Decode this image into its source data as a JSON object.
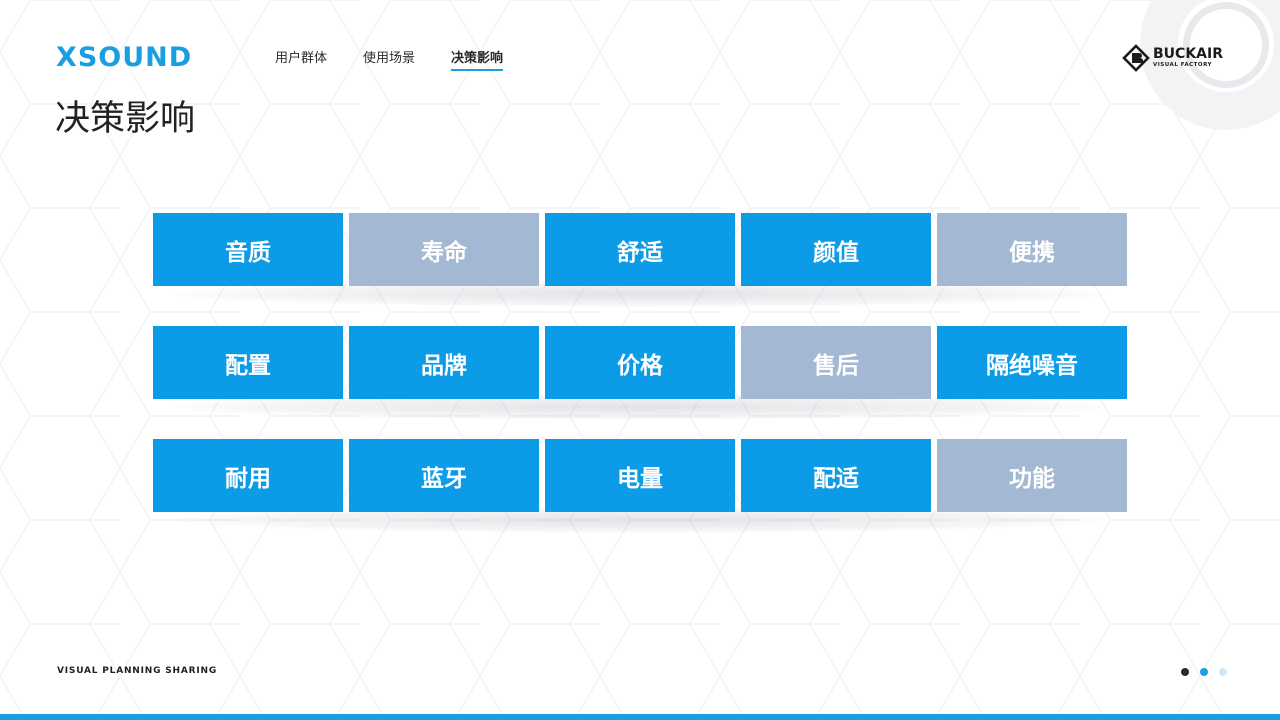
{
  "header": {
    "logo": "XSOUND",
    "nav": [
      {
        "label": "用户群体",
        "active": false
      },
      {
        "label": "使用场景",
        "active": false
      },
      {
        "label": "决策影响",
        "active": true
      }
    ],
    "brand": {
      "name": "BUCKAIR",
      "sub": "VISUAL FACTORY",
      "icon": "buckair-logo-icon"
    }
  },
  "page_title": "决策影响",
  "grid": {
    "rows": [
      [
        {
          "label": "音质",
          "tone": "blue"
        },
        {
          "label": "寿命",
          "tone": "gray"
        },
        {
          "label": "舒适",
          "tone": "blue"
        },
        {
          "label": "颜值",
          "tone": "blue"
        },
        {
          "label": "便携",
          "tone": "gray"
        }
      ],
      [
        {
          "label": "配置",
          "tone": "blue"
        },
        {
          "label": "品牌",
          "tone": "blue"
        },
        {
          "label": "价格",
          "tone": "blue"
        },
        {
          "label": "售后",
          "tone": "gray"
        },
        {
          "label": "隔绝噪音",
          "tone": "blue"
        }
      ],
      [
        {
          "label": "耐用",
          "tone": "blue"
        },
        {
          "label": "蓝牙",
          "tone": "blue"
        },
        {
          "label": "电量",
          "tone": "blue"
        },
        {
          "label": "配适",
          "tone": "blue"
        },
        {
          "label": "功能",
          "tone": "gray"
        }
      ]
    ]
  },
  "footer": {
    "tagline": "VISUAL  PLANNING SHARING",
    "pagination": {
      "total": 3,
      "current": 2
    }
  },
  "colors": {
    "accent_blue": "#0c9be6",
    "muted_gray": "#a3b8d2",
    "dot_dark": "#2b2b2b",
    "dot_active": "#1a9ee2",
    "dot_light": "#cfe6f7",
    "bottom_bar": "#1a9ee2"
  }
}
